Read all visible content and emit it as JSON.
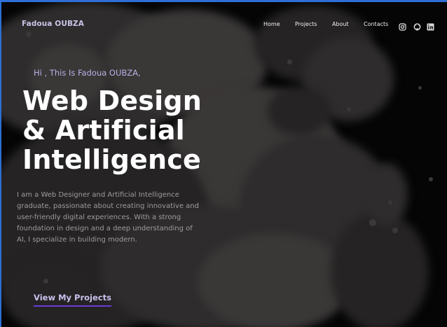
{
  "header": {
    "brand": "Fadoua OUBZA",
    "nav": [
      "Home",
      "Projects",
      "About",
      "Contacts"
    ],
    "social_icons": [
      "instagram-icon",
      "github-icon",
      "linkedin-icon"
    ]
  },
  "hero": {
    "greeting": "Hi , This Is Fadoua OUBZA,",
    "headline_lines": [
      "Web Design",
      "& Artificial",
      "Intelligence"
    ],
    "intro": "I am a Web Designer and Artificial Intelligence graduate, passionate about creating innovative and user-friendly digital experiences. With a strong foundation in design and a deep understanding of AI, I specialize in building modern.",
    "cta_label": "View My Projects"
  },
  "colors": {
    "frame_border": "#2d6fd6",
    "brand": "#c9c5e8",
    "greeting": "#b7b2e6",
    "cta_underline": "#6a3bd8",
    "background": "#050505"
  }
}
